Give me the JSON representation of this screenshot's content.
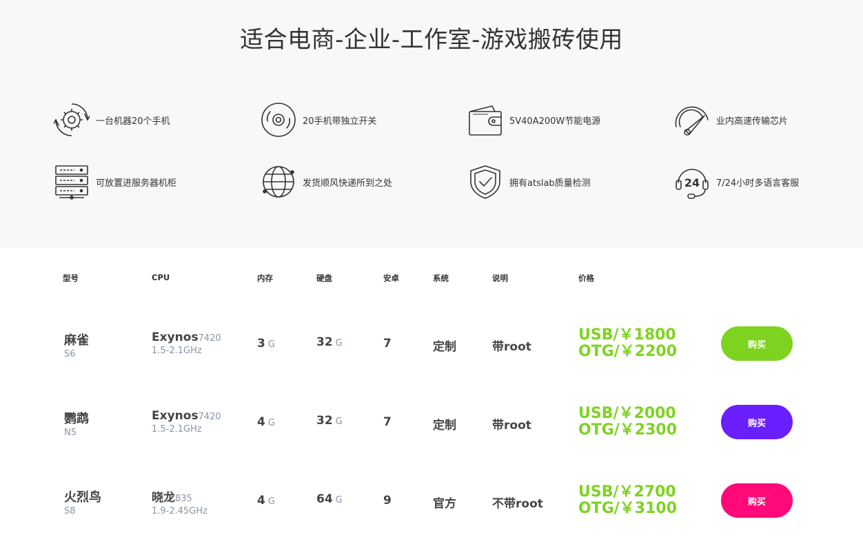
{
  "hero": {
    "title": "适合电商-企业-工作室-游戏搬砖使用",
    "features": [
      {
        "icon": "gear-cycle-icon",
        "text": "一台机器20个手机"
      },
      {
        "icon": "disc-icon",
        "text": "20手机带独立开关"
      },
      {
        "icon": "wallet-icon",
        "text": "5V40A200W节能电源"
      },
      {
        "icon": "speedometer-icon",
        "text": "业内高速传输芯片"
      },
      {
        "icon": "server-rack-icon",
        "text": "可放置进服务器机柜"
      },
      {
        "icon": "globe-icon",
        "text": "发货顺风快递所到之处"
      },
      {
        "icon": "shield-check-icon",
        "text": "拥有atslab质量检测"
      },
      {
        "icon": "headset-24-icon",
        "text": "7/24小时多语言客服",
        "badge": "24"
      }
    ]
  },
  "table": {
    "headers": {
      "model": "型号",
      "cpu": "CPU",
      "ram": "内存",
      "disk": "硬盘",
      "android": "安卓",
      "system": "系统",
      "note": "说明",
      "price": "价格"
    },
    "rows": [
      {
        "name": "麻雀",
        "code": "S6",
        "cpu_name": "Exynos",
        "cpu_model": "7420",
        "cpu_freq": "1.5-2.1GHz",
        "ram": "3",
        "ram_unit": "G",
        "disk": "32",
        "disk_unit": "G",
        "android": "7",
        "system": "定制",
        "note": "带root",
        "price_usb": "USB/￥1800",
        "price_otg": "OTG/￥2200",
        "buy_label": "购买",
        "buy_color": "#7ed321"
      },
      {
        "name": "鹦鹉",
        "code": "N5",
        "cpu_name": "Exynos",
        "cpu_model": "7420",
        "cpu_freq": "1.5-2.1GHz",
        "ram": "4",
        "ram_unit": "G",
        "disk": "32",
        "disk_unit": "G",
        "android": "7",
        "system": "定制",
        "note": "带root",
        "price_usb": "USB/￥2000",
        "price_otg": "OTG/￥2300",
        "buy_label": "购买",
        "buy_color": "#6a1fff"
      },
      {
        "name": "火烈鸟",
        "code": "S8",
        "cpu_name": "晓龙",
        "cpu_model": "835",
        "cpu_freq": "1.9-2.45GHz",
        "ram": "4",
        "ram_unit": "G",
        "disk": "64",
        "disk_unit": "G",
        "android": "9",
        "system": "官方",
        "note": "不带root",
        "price_usb": "USB/￥2700",
        "price_otg": "OTG/￥3100",
        "buy_label": "购买",
        "buy_color": "#ff0a78"
      }
    ]
  },
  "colors": {
    "price": "#7ed321",
    "hero_bg": "#f7f8fa",
    "muted": "#8a94a6"
  }
}
